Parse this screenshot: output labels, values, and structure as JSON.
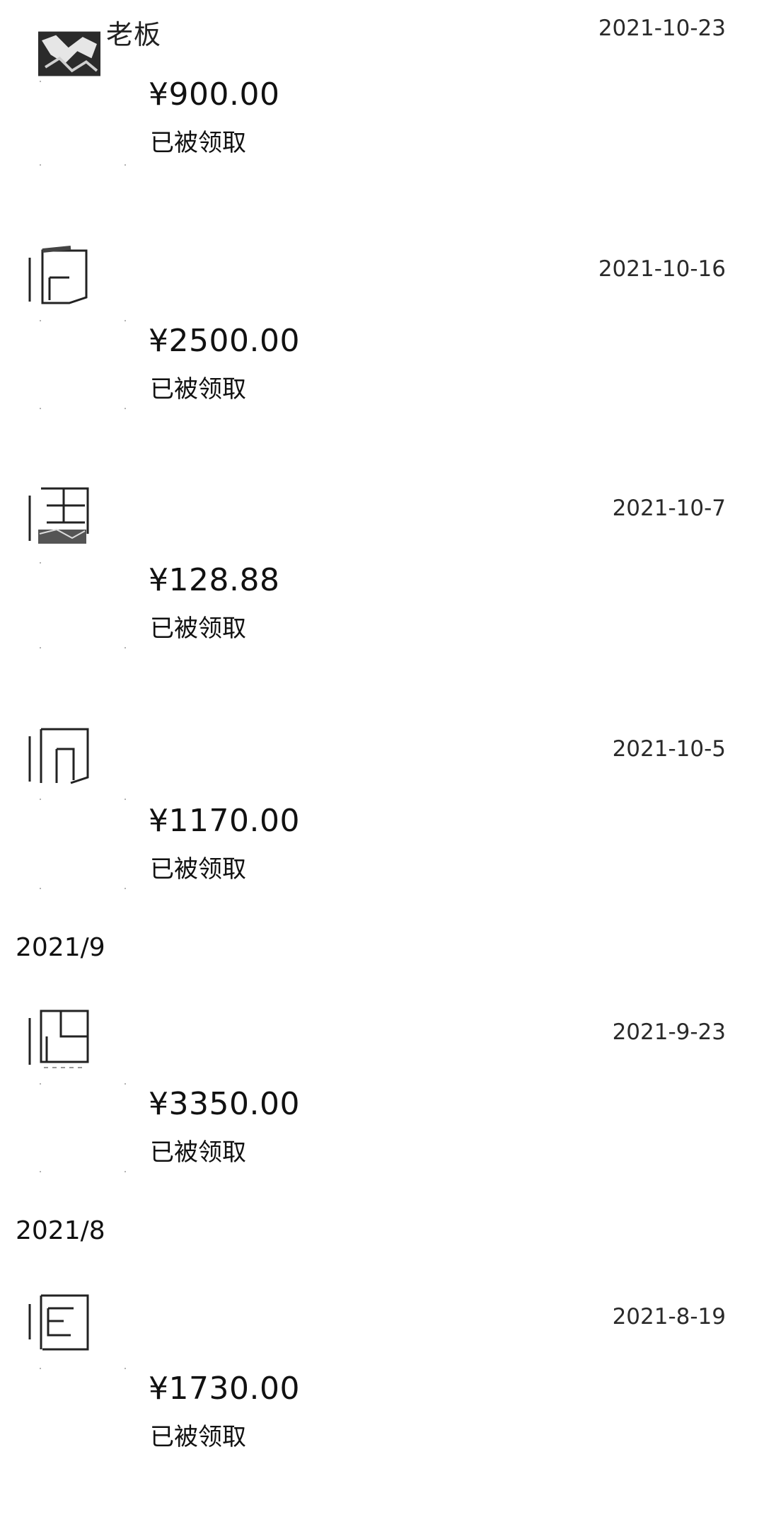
{
  "transfers": [
    {
      "sender": "老板",
      "date": "2021-10-23",
      "amount": "¥900.00",
      "status": "已被领取"
    },
    {
      "sender": "",
      "date": "2021-10-16",
      "amount": "¥2500.00",
      "status": "已被领取"
    },
    {
      "sender": "",
      "date": "2021-10-7",
      "amount": "¥128.88",
      "status": "已被领取"
    },
    {
      "sender": "",
      "date": "2021-10-5",
      "amount": "¥1170.00",
      "status": "已被领取"
    },
    {
      "sender": "",
      "date": "2021-9-23",
      "amount": "¥3350.00",
      "status": "已被领取"
    },
    {
      "sender": "",
      "date": "2021-8-19",
      "amount": "¥1730.00",
      "status": "已被领取"
    }
  ],
  "month_headers": [
    "2021/9",
    "2021/8"
  ],
  "colors": {
    "text": "#111111",
    "date_text": "#2a2a2a",
    "background": "#ffffff"
  },
  "icons": {
    "avatar": "avatar-icon"
  }
}
